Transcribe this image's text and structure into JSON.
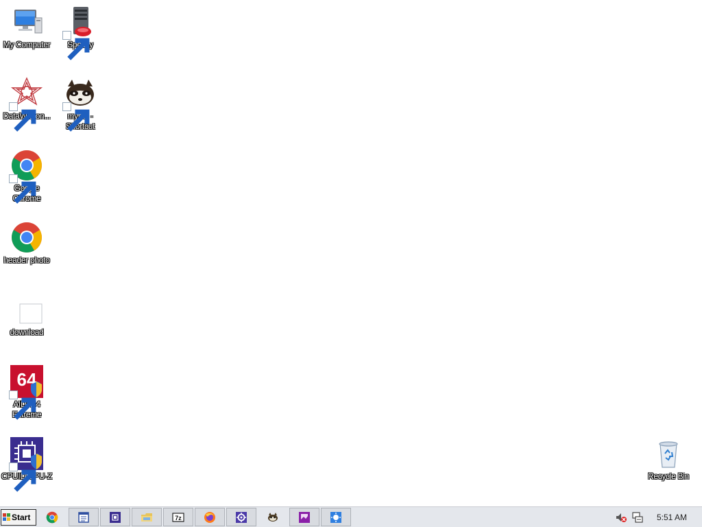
{
  "desktop": {
    "icons": [
      {
        "label": "My Computer"
      },
      {
        "label": "Speccy"
      },
      {
        "label": "DataWagon..."
      },
      {
        "label": "mypal - Shortcut"
      },
      {
        "label": "Google Chrome"
      },
      {
        "label": "header photo"
      },
      {
        "label": "download"
      },
      {
        "label": "AIDA64 Extreme"
      },
      {
        "label": "CPUID CPU-Z"
      },
      {
        "label": "Recycle Bin"
      }
    ]
  },
  "taskbar": {
    "start_label": "Start",
    "buttons": [
      {
        "icon": "chrome-icon"
      },
      {
        "icon": "notepad-icon"
      },
      {
        "icon": "cpu-chip-icon"
      },
      {
        "icon": "file-explorer-icon"
      },
      {
        "icon": "7zip-icon",
        "text": "7z"
      },
      {
        "icon": "firefox-icon"
      },
      {
        "icon": "settings-gear-icon"
      },
      {
        "icon": "mypal-icon"
      },
      {
        "icon": "image-editor-icon"
      },
      {
        "icon": "utility-icon"
      }
    ],
    "tray": {
      "volume_icon": "volume-muted-icon",
      "network_icon": "network-icon",
      "clock": "5:51 AM"
    }
  },
  "colors": {
    "desktop_bg": "#ffffff",
    "taskbar_bg": "#e4e7ec",
    "chrome_red": "#db4437",
    "chrome_yellow": "#f4b400",
    "chrome_green": "#0f9d58",
    "chrome_blue": "#4285f4",
    "aida_red": "#c8102e",
    "cpuz_purple": "#3a2d8f"
  }
}
